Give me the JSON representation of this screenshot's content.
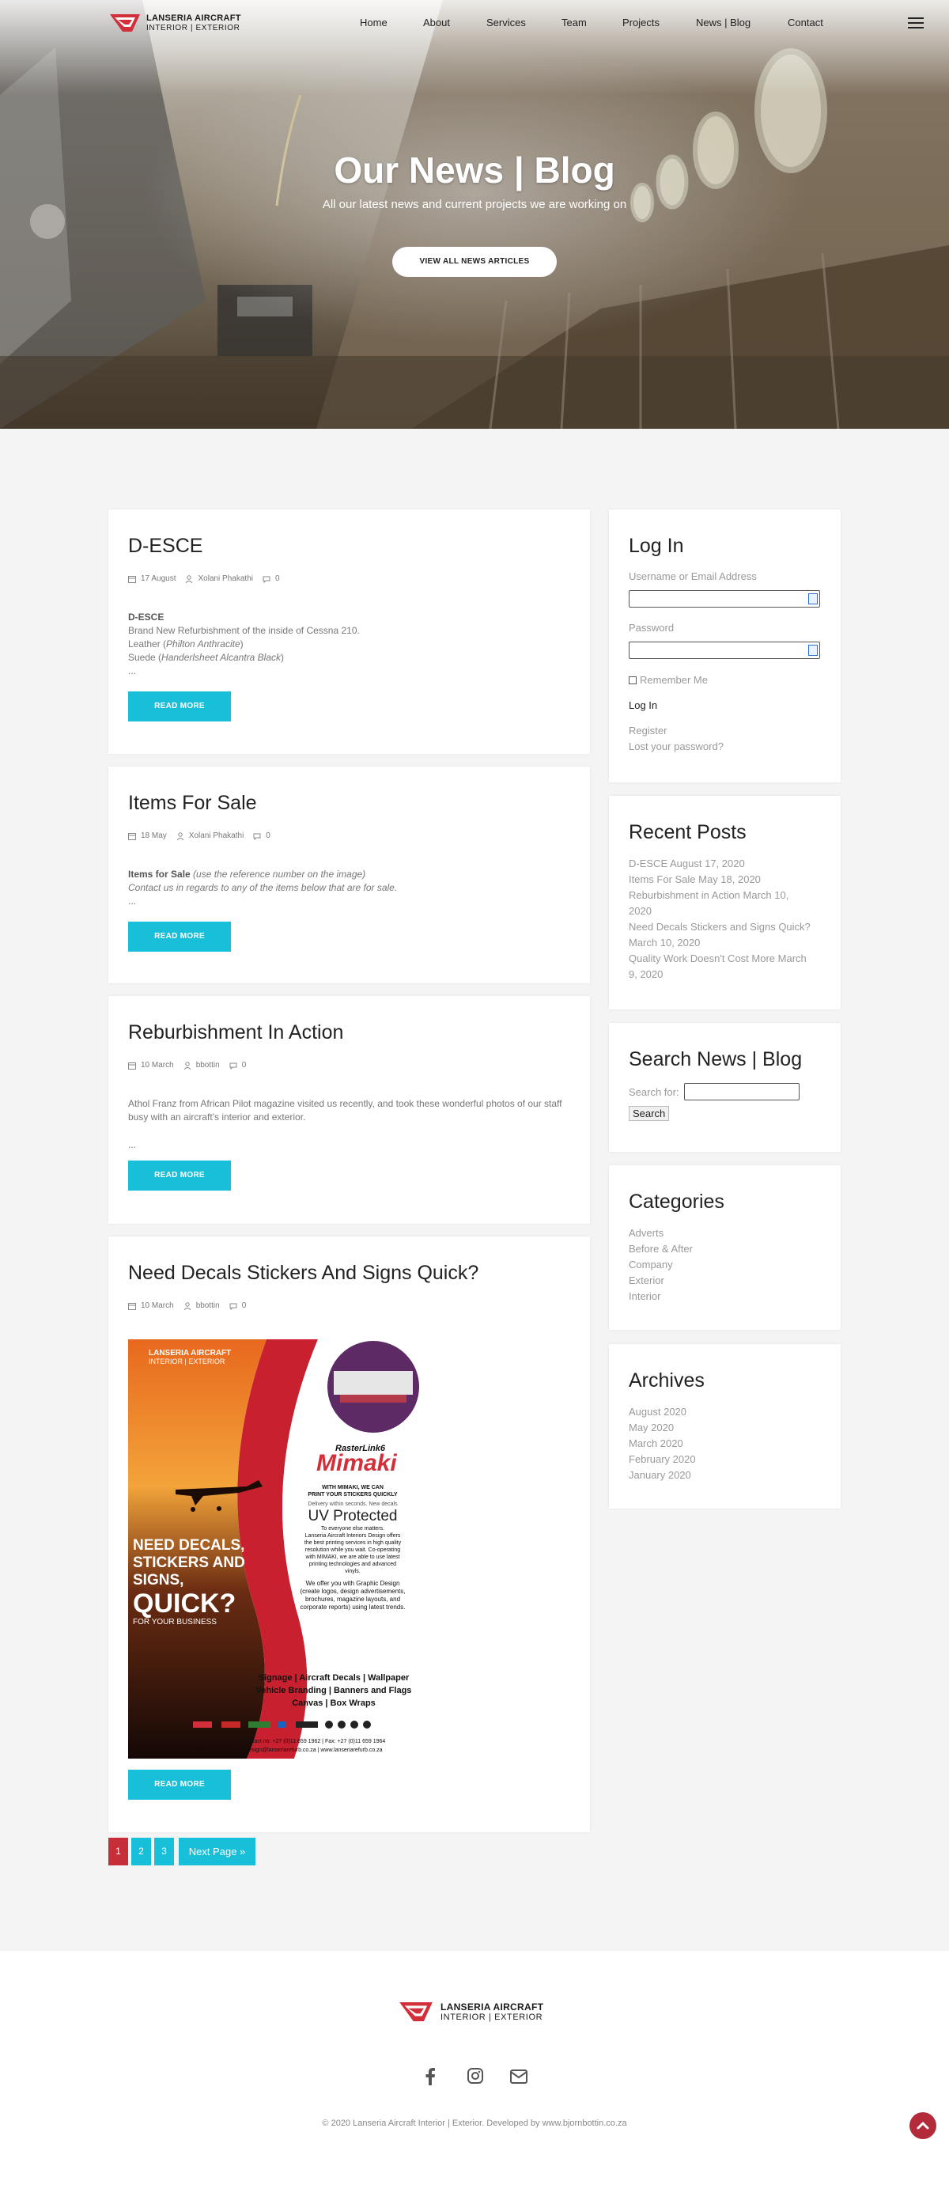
{
  "brand": {
    "name_line1": "LANSERIA AIRCRAFT",
    "name_line2": "INTERIOR | EXTERIOR",
    "accent": "#d32f3a",
    "cyan": "#17bfd8"
  },
  "nav": {
    "items": [
      "Home",
      "About",
      "Services",
      "Team",
      "Projects",
      "News | Blog",
      "Contact"
    ]
  },
  "hero": {
    "title": "Our News | Blog",
    "subtitle": "All our latest news and current projects we are working on",
    "button": "VIEW ALL NEWS ARTICLES"
  },
  "posts": [
    {
      "title": "D-ESCE",
      "date": "17 August",
      "author": "Xolani Phakathi",
      "comments": "0",
      "excerpt_heading": "D-ESCE",
      "excerpt_line1": "Brand New Refurbishment of the inside of Cessna 210.",
      "excerpt_line2_prefix": "Leather (",
      "excerpt_line2_italic": "Philton Anthracite",
      "excerpt_line2_suffix": ")",
      "excerpt_line3_prefix": "Suede (",
      "excerpt_line3_italic": "Handerlsheet Alcantra Black",
      "excerpt_line3_suffix": ")",
      "ellipsis": "...",
      "button": "READ MORE"
    },
    {
      "title": "Items For Sale",
      "date": "18 May",
      "author": "Xolani Phakathi",
      "comments": "0",
      "excerpt_bold": "Items for Sale",
      "excerpt_italic1": "(use the reference number on the image)",
      "excerpt_italic2": "Contact us in regards to any of the items below that are for sale.",
      "ellipsis": "...",
      "button": "READ MORE"
    },
    {
      "title": "Reburbishment In Action",
      "date": "10 March",
      "author": "bbottin",
      "comments": "0",
      "excerpt": "Athol Franz from African Pilot magazine visited us recently, and took these wonderful photos of our staff busy with an aircraft's interior and exterior.",
      "ellipsis": "...",
      "button": "READ MORE"
    },
    {
      "title": "Need Decals Stickers And Signs Quick?",
      "date": "10 March",
      "author": "bbottin",
      "comments": "0",
      "button": "READ MORE",
      "poster": {
        "brand_line1": "LANSERIA AIRCRAFT",
        "brand_line2": "INTERIOR | EXTERIOR",
        "rasterlink": "RasterLink6",
        "mimaki": "Mimaki",
        "with_mimaki1": "WITH MIMAKI, WE CAN",
        "with_mimaki2": "PRINT YOUR STICKERS QUICKLY",
        "delivery": "Delivery within seconds. New decals",
        "uv": "UV Protected",
        "body1": "To everyone else matters.",
        "body2": "Lanseria Aircraft Interiors Design offers",
        "body3": "the best printing services in high quality",
        "body4": "resolution while you wait. Co-operating",
        "body5": "with MIMAKI, we are able to use latest",
        "body6": "printing technologies and advanced",
        "body7": "vinyls.",
        "offer1": "We offer you with Graphic Design",
        "offer2": "(create logos, design advertisements,",
        "offer3": "brochures, magazine layouts, and",
        "offer4": "corporate reports) using latest trends.",
        "services1": "Signage | Aircraft Decals | Wallpaper",
        "services2": "Vehicle Branding | Banners and Flags",
        "services3": "Canvas | Box Wraps",
        "headline1": "NEED DECALS,",
        "headline2": "STICKERS AND",
        "headline3": "SIGNS,",
        "headline4": "QUICK?",
        "headline5": "FOR YOUR BUSINESS",
        "contact": "Contact no: +27 (0)11 659 1962 | Fax: +27 (0)11 659 1964",
        "email": "design@lanseriarefurb.co.za  |  www.lanseriarefurb.co.za"
      }
    }
  ],
  "pagination": [
    "1",
    "2",
    "3",
    "Next Page »"
  ],
  "login": {
    "title": "Log In",
    "username_label": "Username or Email Address",
    "password_label": "Password",
    "remember": "Remember Me",
    "button": "Log In",
    "register": "Register",
    "lost": "Lost your password?"
  },
  "recent": {
    "title": "Recent Posts",
    "items": [
      "D-ESCE August 17, 2020",
      "Items For Sale May 18, 2020",
      "Reburbishment in Action March 10,",
      "2020",
      "Need Decals Stickers and Signs Quick?",
      "March 10, 2020",
      "Quality Work Doesn't Cost More March",
      "9, 2020"
    ]
  },
  "search": {
    "title": "Search News | Blog",
    "label": "Search for:",
    "button": "Search"
  },
  "categories": {
    "title": "Categories",
    "items": [
      "Adverts",
      "Before & After",
      "Company",
      "Exterior",
      "Interior"
    ]
  },
  "archives": {
    "title": "Archives",
    "items": [
      "August 2020",
      "May 2020",
      "March 2020",
      "February 2020",
      "January 2020"
    ]
  },
  "footer": {
    "copyright": "© 2020 Lanseria Aircraft Interior | Exterior. Developed by www.bjornbottin.co.za"
  }
}
